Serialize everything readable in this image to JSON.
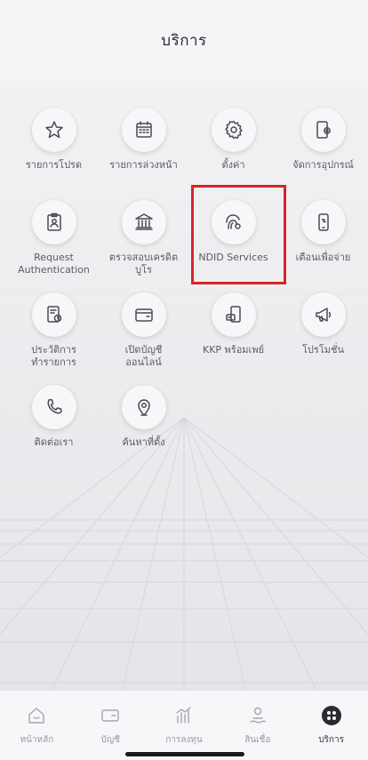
{
  "header": {
    "title": "บริการ"
  },
  "services": [
    {
      "label": "รายการโปรด",
      "icon": "star-icon"
    },
    {
      "label": "รายการล่วงหน้า",
      "icon": "calendar-icon"
    },
    {
      "label": "ตั้งค่า",
      "icon": "gear-icon"
    },
    {
      "label": "จัดการอุปกรณ์",
      "icon": "device-settings-icon"
    },
    {
      "label": "Request\nAuthentication",
      "icon": "clipboard-user-icon"
    },
    {
      "label": "ตรวจสอบเครดิต\nบูโร",
      "icon": "bank-icon"
    },
    {
      "label": "NDID Services",
      "icon": "fingerprint-icon"
    },
    {
      "label": "เตือนเพื่อจ่าย",
      "icon": "phone-alert-icon"
    },
    {
      "label": "ประวัติการ\nทำรายการ",
      "icon": "history-icon"
    },
    {
      "label": "เปิดบัญชี\nออนไลน์",
      "icon": "wallet-icon"
    },
    {
      "label": "KKP พร้อมเพย์",
      "icon": "promptpay-icon"
    },
    {
      "label": "โปรโมชั่น",
      "icon": "megaphone-icon"
    },
    {
      "label": "ติดต่อเรา",
      "icon": "phone-icon"
    },
    {
      "label": "ค้นหาที่ตั้ง",
      "icon": "location-pin-icon"
    }
  ],
  "tabbar": {
    "items": [
      {
        "label": "หน้าหลัก",
        "icon": "home-icon"
      },
      {
        "label": "บัญชี",
        "icon": "card-icon"
      },
      {
        "label": "การลงทุน",
        "icon": "investment-icon"
      },
      {
        "label": "สินเชื่อ",
        "icon": "loan-icon"
      },
      {
        "label": "บริการ",
        "icon": "services-icon"
      }
    ],
    "active_label": "บริการ"
  },
  "colors": {
    "highlight": "#d8232a",
    "background": "#eeeef0",
    "icon": "#4a4a52"
  }
}
